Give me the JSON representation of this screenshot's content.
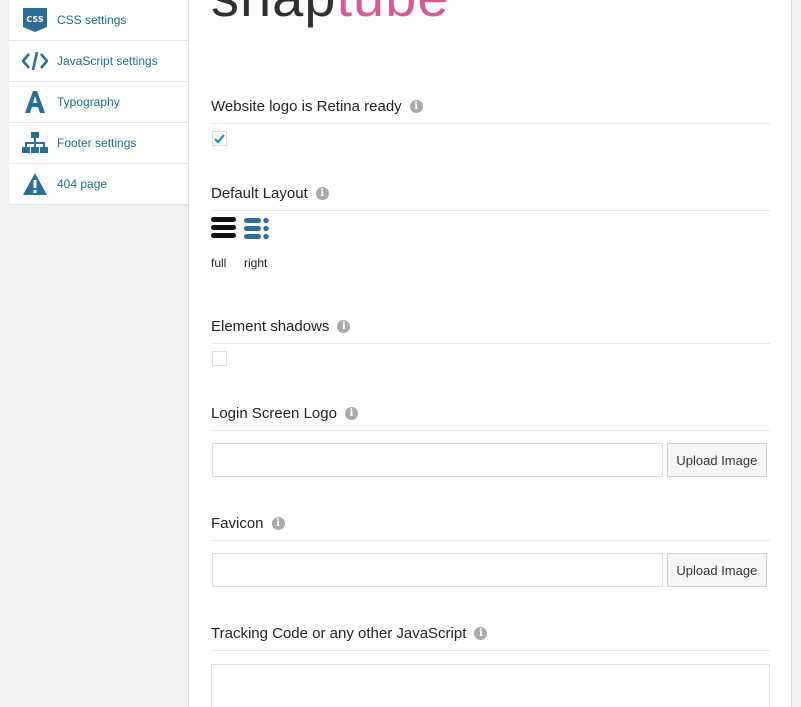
{
  "sidebar": {
    "items": [
      {
        "label": "CSS settings",
        "icon": "css-icon"
      },
      {
        "label": "JavaScript settings",
        "icon": "code-icon"
      },
      {
        "label": "Typography",
        "icon": "typography-icon"
      },
      {
        "label": "Footer settings",
        "icon": "sitemap-icon"
      },
      {
        "label": "404 page",
        "icon": "warning-icon"
      }
    ]
  },
  "logo": {
    "part1": "snap",
    "part2": "tube"
  },
  "sections": {
    "retina": {
      "title": "Website logo is Retina ready",
      "checked": true
    },
    "layout": {
      "title": "Default Layout",
      "options": [
        {
          "label": "full",
          "selected": true
        },
        {
          "label": "right",
          "selected": false
        }
      ]
    },
    "shadows": {
      "title": "Element shadows",
      "checked": false
    },
    "login_logo": {
      "title": "Login Screen Logo",
      "value": "",
      "button": "Upload Image"
    },
    "favicon": {
      "title": "Favicon",
      "value": "",
      "button": "Upload Image"
    },
    "tracking": {
      "title": "Tracking Code or any other JavaScript",
      "value": ""
    }
  },
  "info_glyph": "i",
  "css_badge": "CSS",
  "colors": {
    "accent": "#1e6b95",
    "icon_blue": "#2a6d95",
    "brand_pink": "#d35d92",
    "check_blue": "#1e8cbe"
  }
}
